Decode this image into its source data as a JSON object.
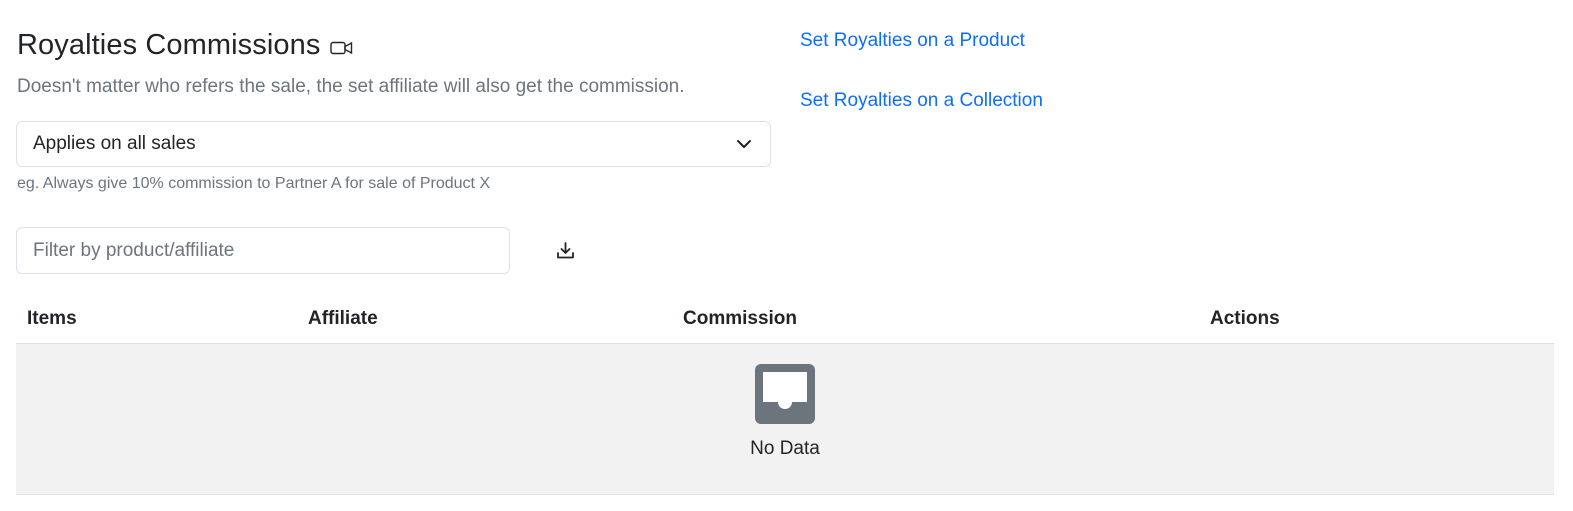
{
  "header": {
    "title": "Royalties Commissions",
    "subtitle": "Doesn't matter who refers the sale, the set affiliate will also get the commission."
  },
  "scope_select": {
    "value": "Applies on all sales",
    "hint": "eg. Always give 10% commission to Partner A for sale of Product X"
  },
  "links": {
    "product": "Set Royalties on a Product",
    "collection": "Set Royalties on a Collection"
  },
  "filter": {
    "placeholder": "Filter by product/affiliate"
  },
  "table": {
    "columns": [
      "Items",
      "Affiliate",
      "Commission",
      "Actions"
    ],
    "empty_text": "No Data"
  },
  "icons": {
    "video": "video-camera-icon",
    "chevron": "chevron-down-icon",
    "download": "download-icon",
    "empty": "inbox-icon"
  },
  "colors": {
    "link": "#0d6efd",
    "muted_text": "#6c757d",
    "empty_bg": "#f2f2f2",
    "empty_icon": "#6c757d"
  }
}
